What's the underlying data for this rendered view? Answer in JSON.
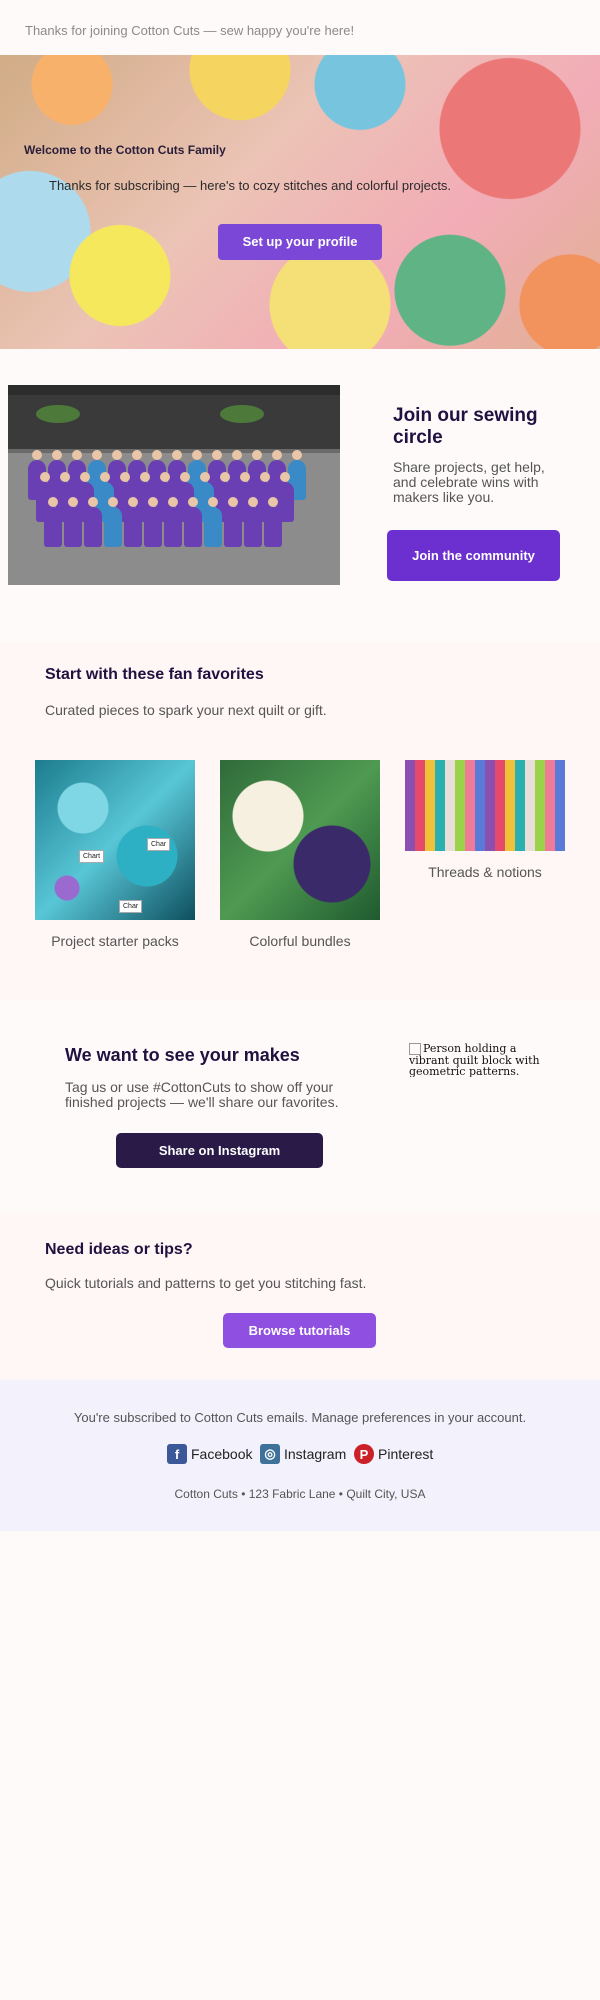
{
  "preheader": "Thanks for joining Cotton Cuts — sew happy you're here!",
  "hero": {
    "title": "Welcome to the Cotton Cuts Family",
    "subtitle": "Thanks for subscribing — here's to cozy stitches and colorful projects.",
    "button": "Set up your profile"
  },
  "community": {
    "title": "Join our sewing circle",
    "text": "Share projects, get help, and celebrate wins with makers like you.",
    "button": "Join the community"
  },
  "favorites": {
    "title": "Start with these fan favorites",
    "subtitle": "Curated pieces to spark your next quilt or gift.",
    "items": [
      {
        "label": "Project starter packs"
      },
      {
        "label": "Colorful bundles"
      },
      {
        "label": "Threads & notions"
      }
    ]
  },
  "makes": {
    "title": "We want to see your makes",
    "text": "Tag us or use #CottonCuts to show off your finished projects — we'll share our favorites.",
    "button": "Share on Instagram",
    "image_alt": "Person holding a vibrant quilt block with geometric patterns."
  },
  "tips": {
    "title": "Need ideas or tips?",
    "subtitle": "Quick tutorials and patterns to get you stitching fast.",
    "button": "Browse tutorials"
  },
  "footer": {
    "note": "You're subscribed to Cotton Cuts emails. Manage preferences in your account.",
    "social": [
      {
        "label": "Facebook",
        "icon": "facebook-icon",
        "color": "#3b5998",
        "glyph": "f"
      },
      {
        "label": "Instagram",
        "icon": "instagram-icon",
        "color": "#3f729b",
        "glyph": "◎"
      },
      {
        "label": "Pinterest",
        "icon": "pinterest-icon",
        "color": "#cb2027",
        "glyph": "P"
      }
    ],
    "address": "Cotton Cuts • 123 Fabric Lane • Quilt City, USA"
  },
  "colors": {
    "primary": "#7b47d6",
    "community_button": "#6c2fd0",
    "dark_button": "#2a1a48",
    "tips_button": "#8f4fe0",
    "heading": "#1f1240"
  }
}
